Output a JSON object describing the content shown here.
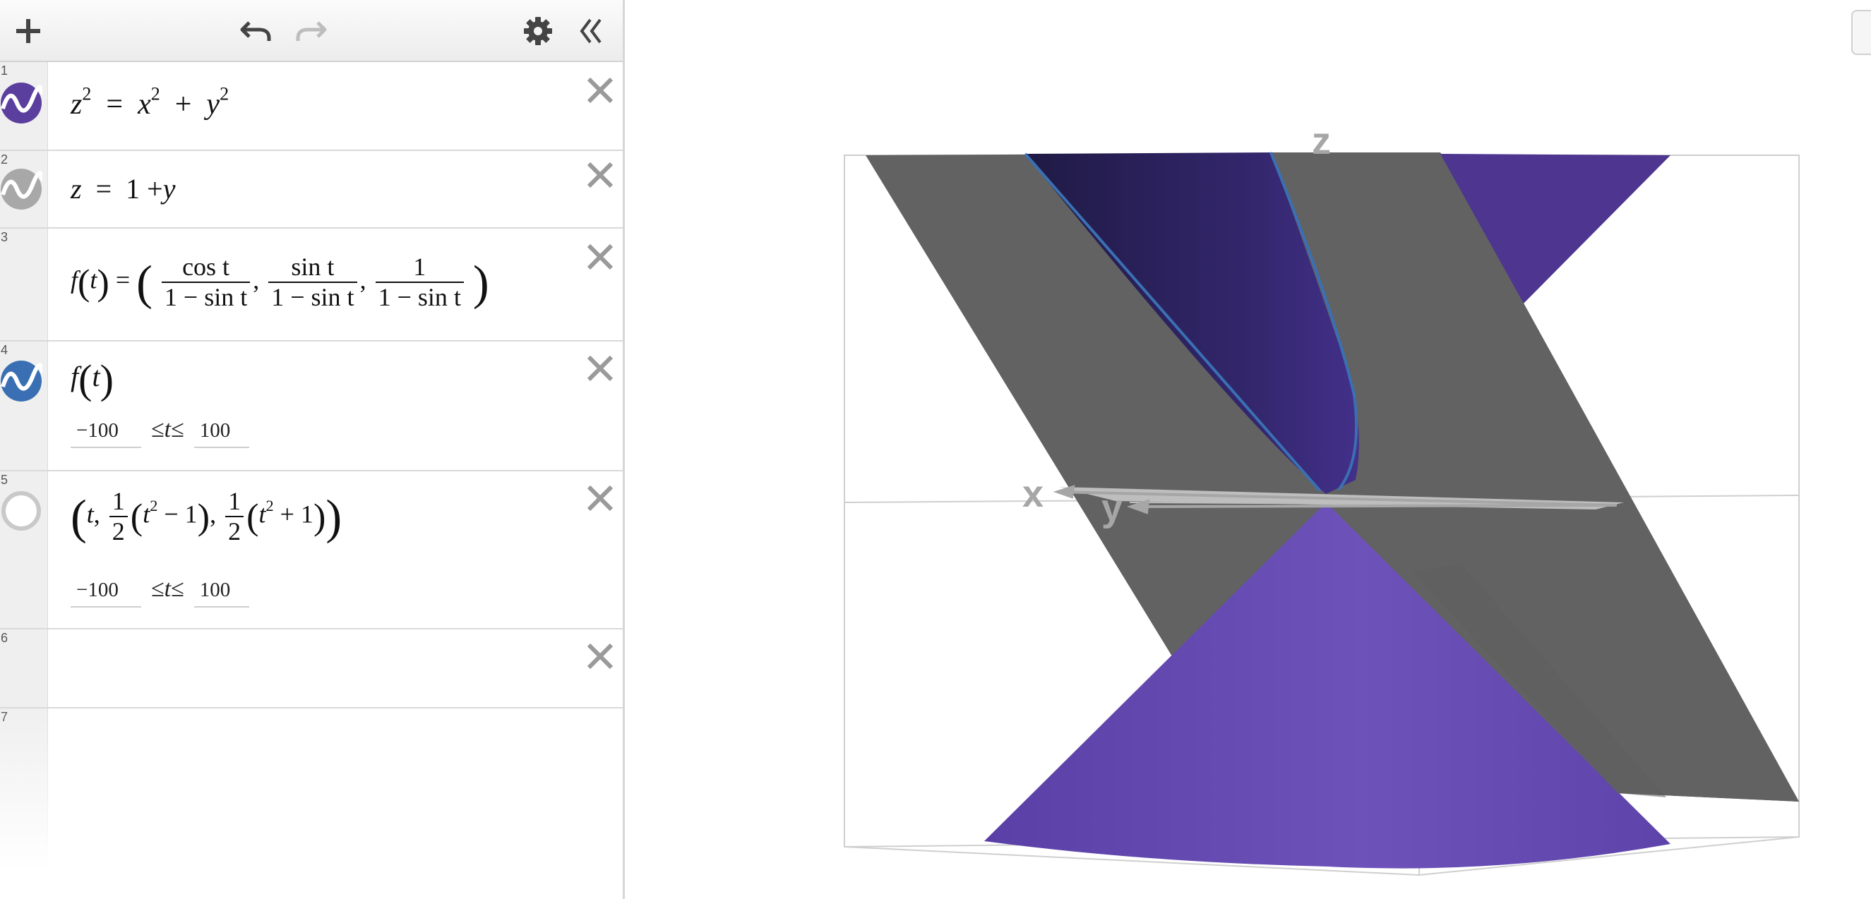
{
  "toolbar": {
    "add_icon": "plus-icon",
    "undo_icon": "undo-icon",
    "redo_icon": "redo-icon",
    "settings_icon": "gear-icon",
    "collapse_icon": "double-chevron-left-icon"
  },
  "expressions": [
    {
      "number": "1",
      "icon_color": "#5b3f9e",
      "icon": "wave-icon"
    },
    {
      "number": "2",
      "icon_color": "#a8a8a8",
      "icon": "wave-icon"
    },
    {
      "number": "3"
    },
    {
      "number": "4",
      "icon_color": "#3a70b3",
      "icon": "wave-icon",
      "domain_min": "−100",
      "domain_max": "100"
    },
    {
      "number": "5",
      "icon_color": "#c9c9c9",
      "icon": "hidden-circle-icon",
      "domain_min": "−100",
      "domain_max": "100"
    },
    {
      "number": "6"
    },
    {
      "number": "7"
    }
  ],
  "math": {
    "frac_num_cos": "cos t",
    "frac_num_sin": "sin t",
    "frac_num_one": "1",
    "frac_den": "1 − sin t",
    "half_num": "1",
    "half_den": "2"
  },
  "graph": {
    "axis_labels": {
      "x": "x",
      "y": "y",
      "z": "z"
    },
    "colors": {
      "cone": "#6a4fb5",
      "cone_dark": "#2f2466",
      "plane": "#626262",
      "curve": "#3a70b3",
      "box": "#cfcfcf",
      "axis": "#a6a6a6"
    }
  }
}
